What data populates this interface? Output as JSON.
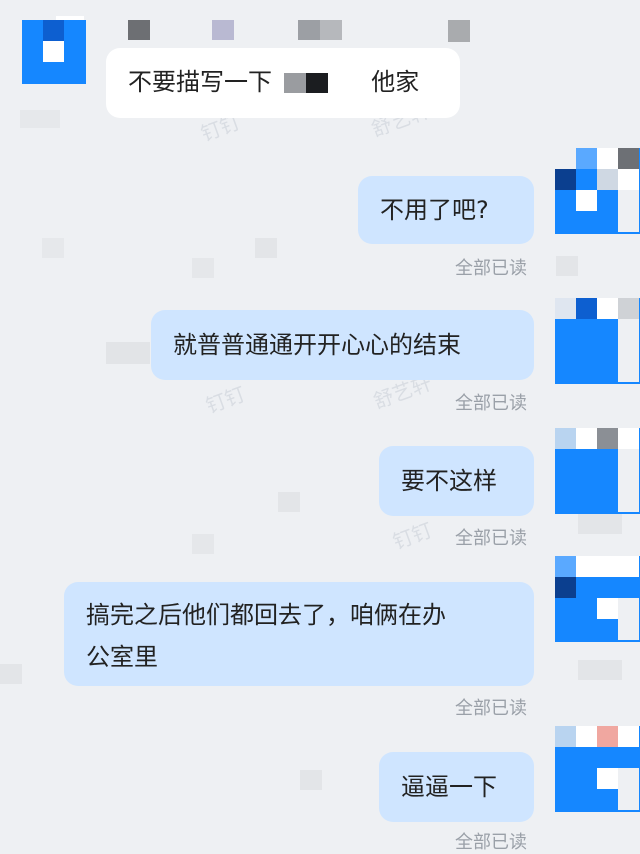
{
  "chat": {
    "messages": [
      {
        "side": "left",
        "text_a": "不要描写一下",
        "text_b": "他家"
      },
      {
        "side": "right",
        "text": "不用了吧?",
        "status": "全部已读"
      },
      {
        "side": "right",
        "text": "就普普通通开开心心的结束",
        "status": "全部已读"
      },
      {
        "side": "right",
        "text": "要不这样",
        "status": "全部已读"
      },
      {
        "side": "right",
        "text_line1": "搞完之后他们都回去了，咱俩在办",
        "text_line2": "公室里",
        "status": "全部已读"
      },
      {
        "side": "right",
        "text": "逼逼一下",
        "status": "全部已读"
      }
    ]
  },
  "colors": {
    "background": "#eef0f3",
    "sent_bubble": "#cfe5ff",
    "received_bubble": "#ffffff",
    "avatar_blue": "#1587ff",
    "read_status": "#9aa0a8"
  }
}
